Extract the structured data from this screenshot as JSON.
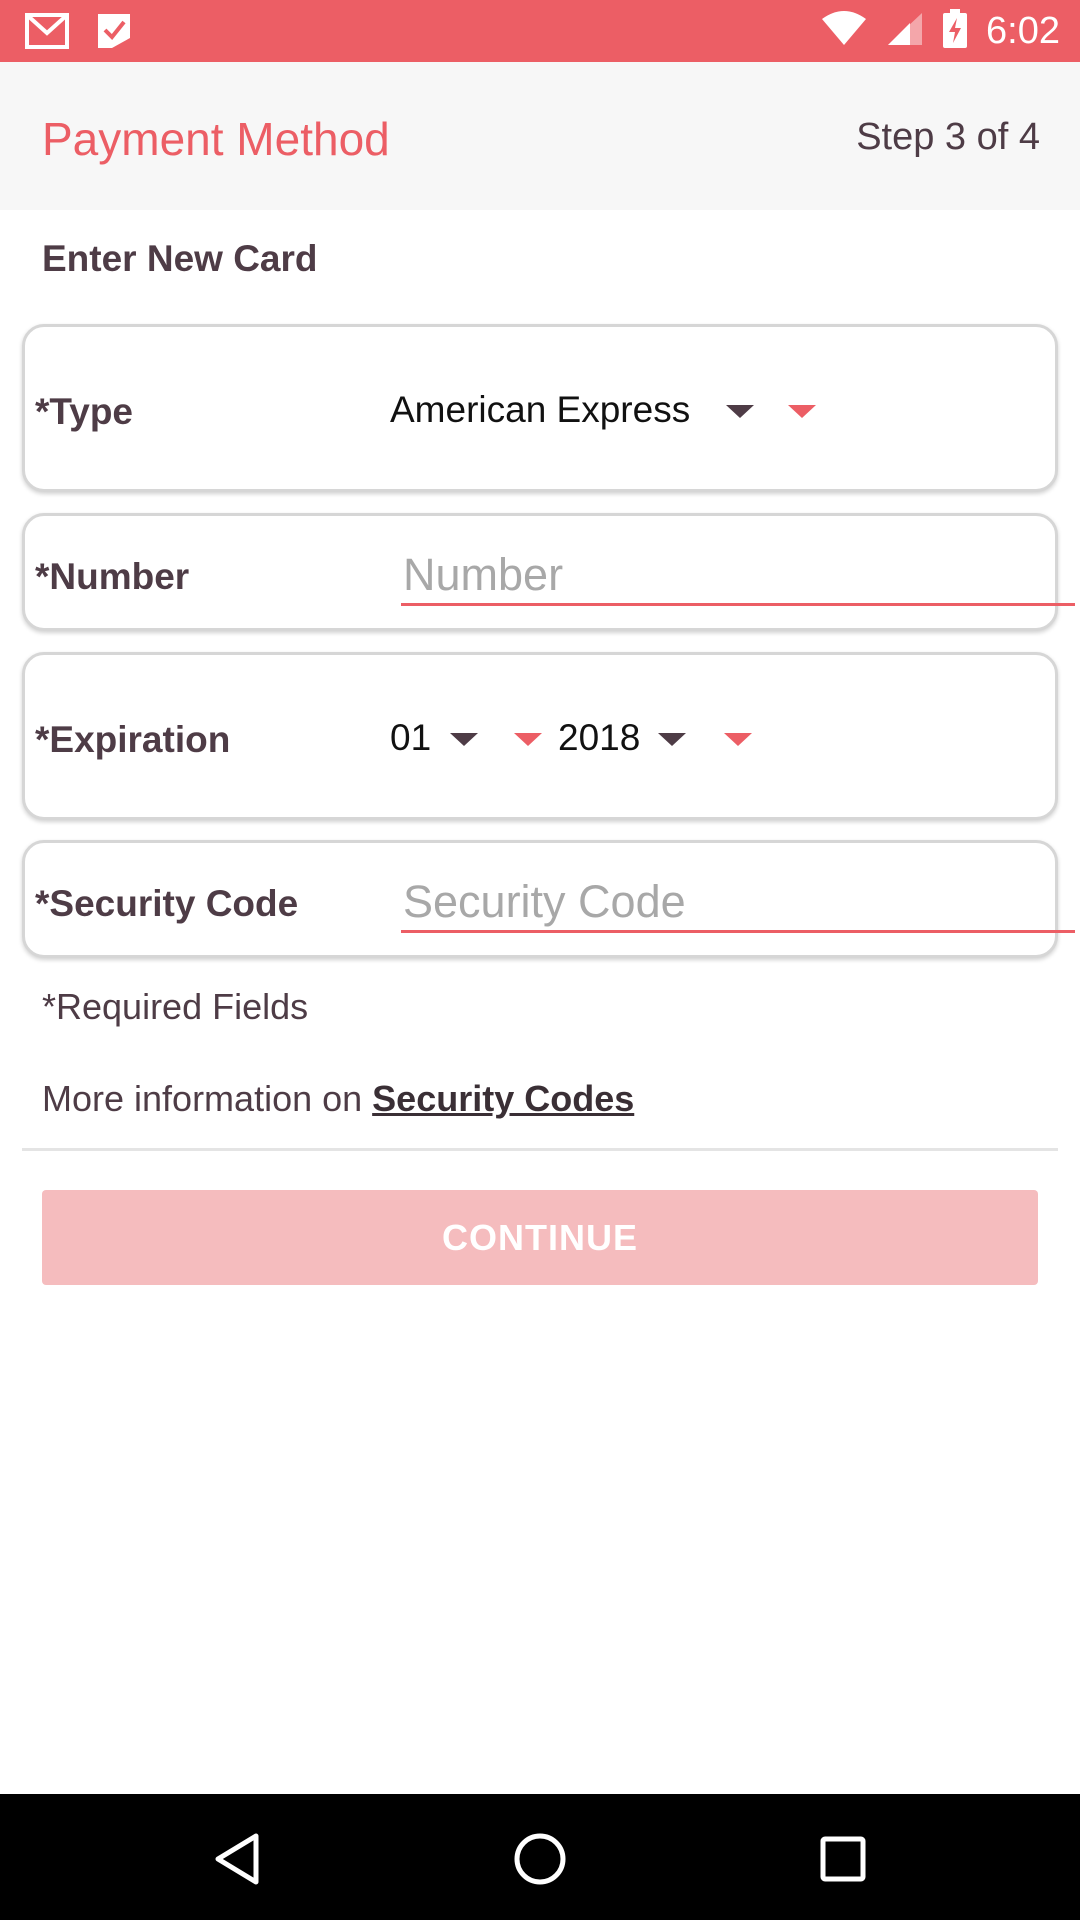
{
  "status_bar": {
    "time": "6:02",
    "icons": [
      "gmail-icon",
      "checklist-icon",
      "wifi-icon",
      "signal-icon",
      "battery-charging-icon"
    ]
  },
  "header": {
    "title": "Payment Method",
    "step": "Step 3 of 4"
  },
  "form": {
    "section_title": "Enter New Card",
    "type": {
      "label": "*Type",
      "value": "American Express"
    },
    "number": {
      "label": "*Number",
      "placeholder": "Number"
    },
    "expiration": {
      "label": "*Expiration",
      "month": "01",
      "year": "2018"
    },
    "security_code": {
      "label": "*Security Code",
      "placeholder": "Security Code"
    }
  },
  "footer_text": {
    "required": "*Required Fields",
    "more_info_prefix": "More information on ",
    "more_info_link": "Security Codes"
  },
  "continue_button": {
    "label": "CONTINUE",
    "enabled": false
  },
  "nav_bar": {
    "buttons": [
      "back-icon",
      "home-icon",
      "recents-icon"
    ]
  },
  "colors": {
    "accent": "#ec5e65",
    "text": "#4e3c46",
    "button_disabled": "#f5bcbe",
    "header_bg": "#f7f7f7"
  }
}
